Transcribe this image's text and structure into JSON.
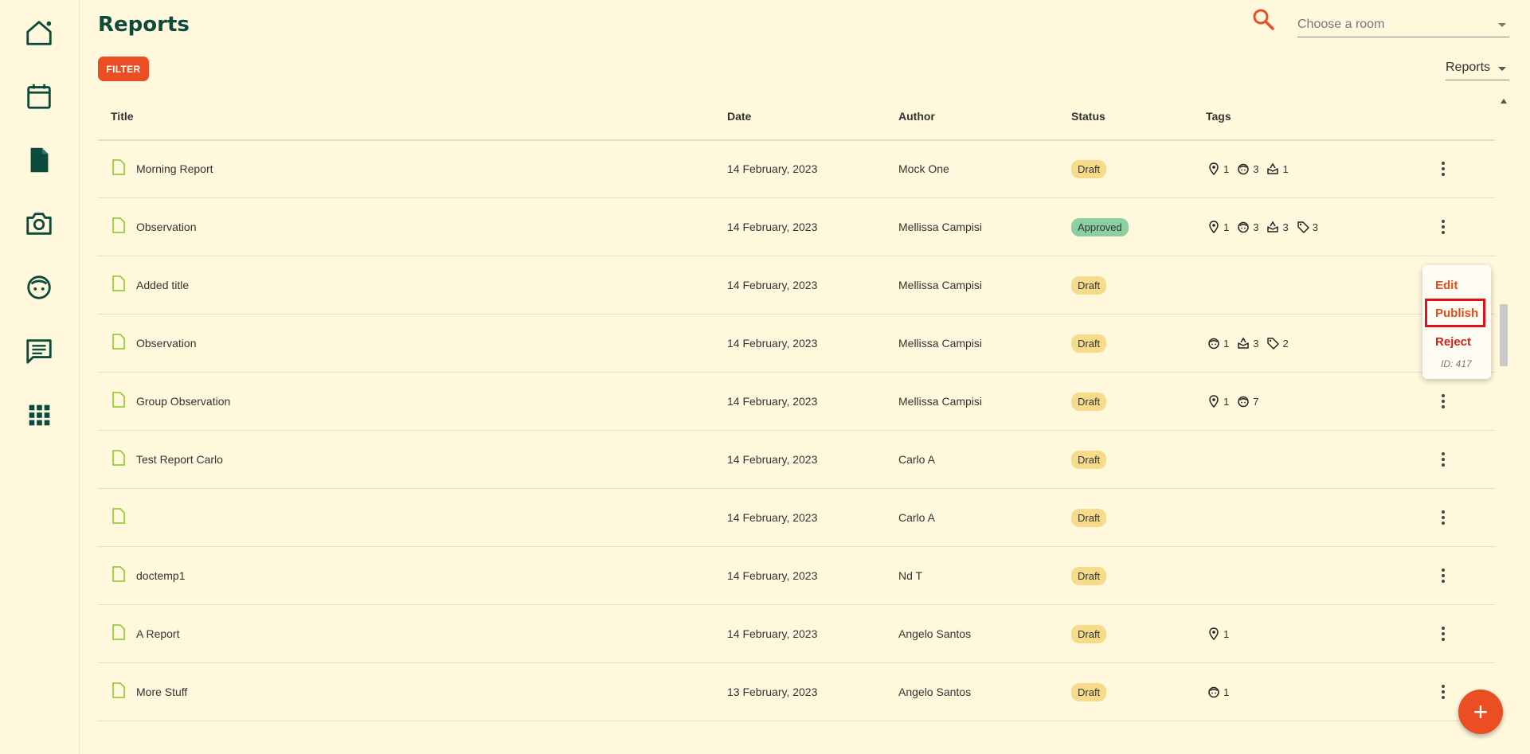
{
  "app": {
    "title": "Reports"
  },
  "sidebar": {
    "items": [
      {
        "name": "home",
        "icon": "home-icon"
      },
      {
        "name": "calendar",
        "icon": "calendar-icon"
      },
      {
        "name": "reports",
        "icon": "document-icon"
      },
      {
        "name": "photos",
        "icon": "camera-icon"
      },
      {
        "name": "children",
        "icon": "child-face-icon"
      },
      {
        "name": "messages",
        "icon": "chat-icon"
      },
      {
        "name": "apps",
        "icon": "apps-grid-icon"
      }
    ]
  },
  "header": {
    "room_placeholder": "Choose a room",
    "filter_label": "FILTER",
    "view_select": "Reports"
  },
  "table": {
    "columns": [
      "Title",
      "Date",
      "Author",
      "Status",
      "Tags"
    ],
    "rows": [
      {
        "title": "Morning Report",
        "date": "14 February, 2023",
        "author": "Mock One",
        "status": "Draft",
        "tags": [
          {
            "type": "location",
            "count": "1"
          },
          {
            "type": "child",
            "count": "3"
          },
          {
            "type": "learning",
            "count": "1"
          }
        ]
      },
      {
        "title": "Observation",
        "date": "14 February, 2023",
        "author": "Mellissa Campisi",
        "status": "Approved",
        "tags": [
          {
            "type": "location",
            "count": "1"
          },
          {
            "type": "child",
            "count": "3"
          },
          {
            "type": "learning",
            "count": "3"
          },
          {
            "type": "label",
            "count": "3"
          }
        ]
      },
      {
        "title": "Added title",
        "date": "14 February, 2023",
        "author": "Mellissa Campisi",
        "status": "Draft",
        "tags": []
      },
      {
        "title": "Observation",
        "date": "14 February, 2023",
        "author": "Mellissa Campisi",
        "status": "Draft",
        "tags": [
          {
            "type": "child",
            "count": "1"
          },
          {
            "type": "learning",
            "count": "3"
          },
          {
            "type": "label",
            "count": "2"
          }
        ]
      },
      {
        "title": "Group Observation",
        "date": "14 February, 2023",
        "author": "Mellissa Campisi",
        "status": "Draft",
        "tags": [
          {
            "type": "location",
            "count": "1"
          },
          {
            "type": "child",
            "count": "7"
          }
        ]
      },
      {
        "title": "Test Report Carlo",
        "date": "14 February, 2023",
        "author": "Carlo A",
        "status": "Draft",
        "tags": []
      },
      {
        "title": "",
        "date": "14 February, 2023",
        "author": "Carlo A",
        "status": "Draft",
        "tags": []
      },
      {
        "title": "doctemp1",
        "date": "14 February, 2023",
        "author": "Nd T",
        "status": "Draft",
        "tags": []
      },
      {
        "title": "A Report",
        "date": "14 February, 2023",
        "author": "Angelo Santos",
        "status": "Draft",
        "tags": [
          {
            "type": "location",
            "count": "1"
          }
        ]
      },
      {
        "title": "More Stuff",
        "date": "13 February, 2023",
        "author": "Angelo Santos",
        "status": "Draft",
        "tags": [
          {
            "type": "child",
            "count": "1"
          }
        ]
      }
    ]
  },
  "context_menu": {
    "edit": "Edit",
    "publish": "Publish",
    "reject": "Reject",
    "id_text": "ID: 417"
  },
  "fab": {
    "label": "+"
  },
  "colors": {
    "background": "#fff8dc",
    "primary_dark": "#0c4a3c",
    "accent": "#ea4e22",
    "draft": "#f6dc8a",
    "approved": "#8ccfa0",
    "doc_icon": "#9acb3c"
  }
}
